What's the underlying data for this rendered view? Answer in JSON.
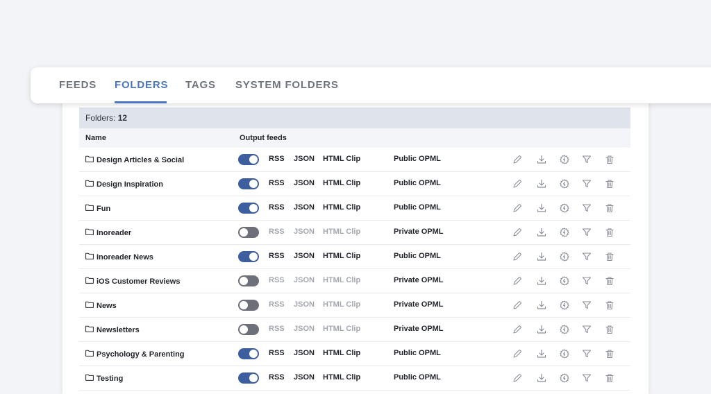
{
  "tabs": [
    {
      "label": "FEEDS",
      "active": false
    },
    {
      "label": "FOLDERS",
      "active": true
    },
    {
      "label": "TAGS",
      "active": false
    },
    {
      "label": "SYSTEM FOLDERS",
      "active": false
    }
  ],
  "summary": {
    "label": "Folders:",
    "count": "12"
  },
  "columns": {
    "name": "Name",
    "output": "Output feeds"
  },
  "colors": {
    "accent": "#4a77bf",
    "toggle_on": "#3d5f9f",
    "toggle_off": "#6d7078"
  },
  "rows": [
    {
      "name": "Design Articles & Social",
      "enabled": true,
      "rss": "RSS",
      "json": "JSON",
      "html": "HTML Clip",
      "opml": "Public OPML"
    },
    {
      "name": "Design Inspiration",
      "enabled": true,
      "rss": "RSS",
      "json": "JSON",
      "html": "HTML Clip",
      "opml": "Public OPML"
    },
    {
      "name": "Fun",
      "enabled": true,
      "rss": "RSS",
      "json": "JSON",
      "html": "HTML Clip",
      "opml": "Public OPML"
    },
    {
      "name": "Inoreader",
      "enabled": false,
      "rss": "RSS",
      "json": "JSON",
      "html": "HTML Clip",
      "opml": "Private OPML"
    },
    {
      "name": "Inoreader News",
      "enabled": true,
      "rss": "RSS",
      "json": "JSON",
      "html": "HTML Clip",
      "opml": "Public OPML"
    },
    {
      "name": "iOS Customer Reviews",
      "enabled": false,
      "rss": "RSS",
      "json": "JSON",
      "html": "HTML Clip",
      "opml": "Private OPML"
    },
    {
      "name": "News",
      "enabled": false,
      "rss": "RSS",
      "json": "JSON",
      "html": "HTML Clip",
      "opml": "Private OPML"
    },
    {
      "name": "Newsletters",
      "enabled": false,
      "rss": "RSS",
      "json": "JSON",
      "html": "HTML Clip",
      "opml": "Private OPML"
    },
    {
      "name": "Psychology & Parenting",
      "enabled": true,
      "rss": "RSS",
      "json": "JSON",
      "html": "HTML Clip",
      "opml": "Public OPML"
    },
    {
      "name": "Testing",
      "enabled": true,
      "rss": "RSS",
      "json": "JSON",
      "html": "HTML Clip",
      "opml": "Public OPML"
    }
  ],
  "row_actions": [
    "pencil-icon",
    "download-icon",
    "rules-icon",
    "filter-icon",
    "trash-icon"
  ]
}
